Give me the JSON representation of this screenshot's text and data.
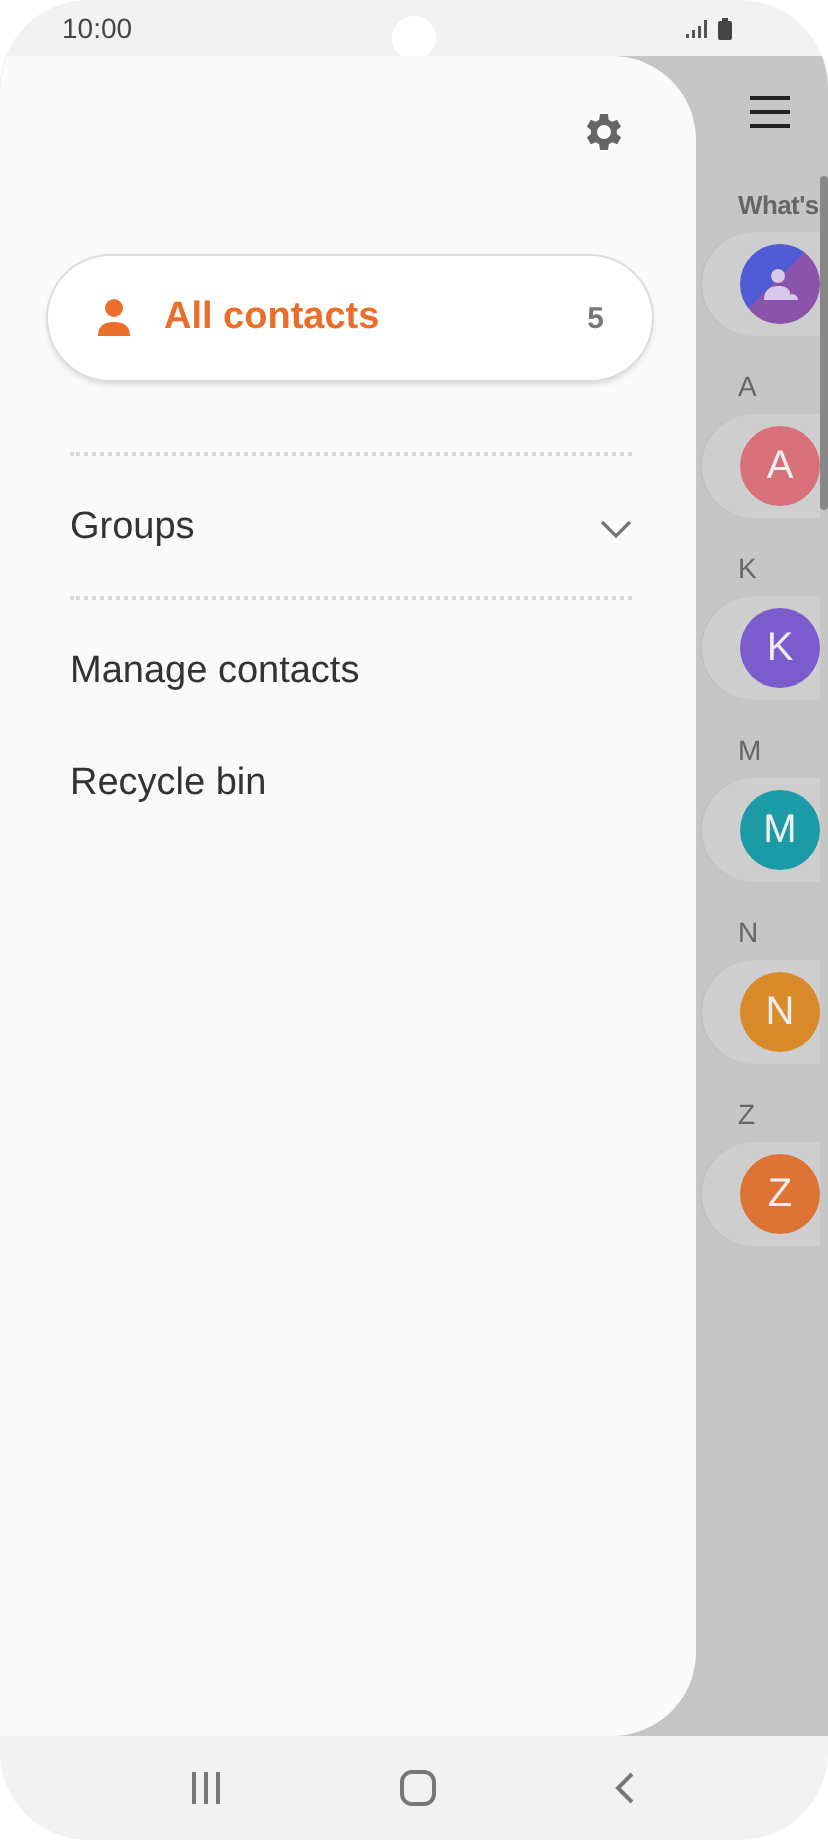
{
  "status_bar": {
    "time": "10:00"
  },
  "drawer": {
    "items": [
      {
        "label": "All contacts",
        "count": "5",
        "selected": true
      }
    ],
    "groups": {
      "label": "Groups",
      "expanded": false
    },
    "links": [
      "Manage contacts",
      "Recycle bin"
    ]
  },
  "contact_list": {
    "section_label": "What's",
    "sections": [
      {
        "header": "A",
        "initial": "A",
        "color": "#d9717b"
      },
      {
        "header": "K",
        "initial": "K",
        "color": "#7c5ccc"
      },
      {
        "header": "M",
        "initial": "M",
        "color": "#1b9ba6"
      },
      {
        "header": "N",
        "initial": "N",
        "color": "#d98b2c"
      },
      {
        "header": "Z",
        "initial": "Z",
        "color": "#dd7436"
      }
    ]
  }
}
